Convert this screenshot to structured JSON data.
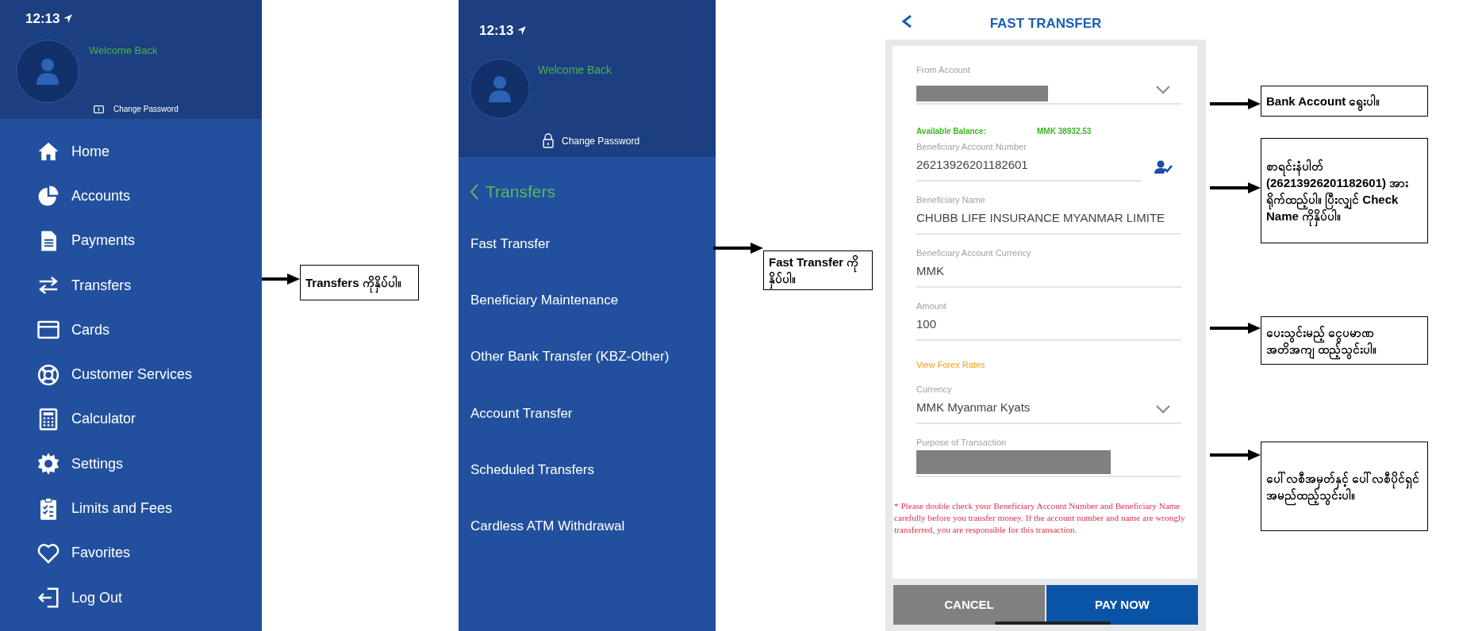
{
  "menu_screen": {
    "status_time": "12:13",
    "welcome": "Welcome Back",
    "change_password": "Change Password",
    "items": [
      {
        "label": "Home"
      },
      {
        "label": "Accounts"
      },
      {
        "label": "Payments"
      },
      {
        "label": "Transfers"
      },
      {
        "label": "Cards"
      },
      {
        "label": "Customer Services"
      },
      {
        "label": "Calculator"
      },
      {
        "label": "Settings"
      },
      {
        "label": "Limits and Fees"
      },
      {
        "label": "Favorites"
      },
      {
        "label": "Log Out"
      }
    ]
  },
  "transfers_screen": {
    "status_time": "12:13",
    "welcome": "Welcome Back",
    "change_password": "Change Password",
    "back_label": "Transfers",
    "items": [
      {
        "label": "Fast Transfer"
      },
      {
        "label": "Beneficiary Maintenance"
      },
      {
        "label": "Other Bank Transfer (KBZ-Other)"
      },
      {
        "label": "Account Transfer"
      },
      {
        "label": "Scheduled Transfers"
      },
      {
        "label": "Cardless ATM Withdrawal"
      }
    ]
  },
  "fast_transfer_screen": {
    "title": "FAST TRANSFER",
    "rows": [
      {
        "kind": "select",
        "label": "From Account",
        "redacted": true
      },
      {
        "kind": "balance",
        "label": "Available Balance:",
        "value": "MMK 38932.53"
      },
      {
        "kind": "lookup",
        "label": "Beneficiary Account Number",
        "value": "26213926201182601"
      },
      {
        "kind": "text",
        "label": "Beneficiary Name",
        "value": "CHUBB LIFE INSURANCE MYANMAR LIMITE"
      },
      {
        "kind": "text",
        "label": "Beneficiary Account Currency",
        "value": "MMK"
      },
      {
        "kind": "text",
        "label": "Amount",
        "value": "100"
      },
      {
        "kind": "link",
        "label": "View Forex Rates"
      },
      {
        "kind": "select",
        "label": "Currency",
        "value": "MMK Myanmar Kyats"
      },
      {
        "kind": "text",
        "label": "Purpose of Transaction",
        "redacted": true
      }
    ],
    "note": "* Please double check your Beneficiary Account Number and Beneficiary Name carefully before you transfer money. If the account number and name are wrongly transferred, you are responsible for this transaction.",
    "buttons": [
      {
        "label": "CANCEL",
        "kind": "secondary"
      },
      {
        "label": "PAY NOW",
        "kind": "primary"
      }
    ]
  },
  "callouts": [
    {
      "text": "Transfers ကိုနှိပ်ပါ။"
    },
    {
      "text": "Fast Transfer ကိုနှိပ်ပါ။"
    },
    {
      "text": "Bank Account ရွေးပါ။"
    },
    {
      "text": "စာရင်းနံပါတ် (26213926201182601) အား ရိုက်ထည့်ပါ။ ပြီးလျှင် Check Name ကိုနှိပ်ပါ။"
    },
    {
      "text": "ပေးသွင်းမည့် ငွေပမာဏ အတိအကျ ထည့်သွင်းပါ။"
    },
    {
      "text": "ပေါ်လစီအမှတ်နှင့် ပေါ်လစီပိုင်ရှင်အမည်ထည့်သွင်းပါ။"
    }
  ]
}
